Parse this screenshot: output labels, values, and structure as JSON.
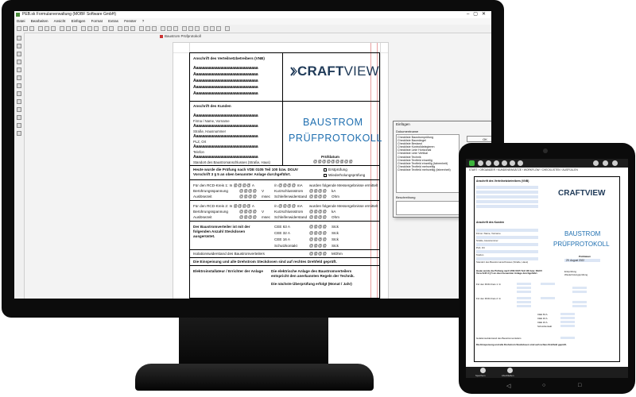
{
  "desktop": {
    "window_title": "PEB.sk Formularverwaltung (MOBF Software GmbH)",
    "menu": [
      "Datei",
      "Bearbeiten",
      "Ansicht",
      "Einfügen",
      "Format",
      "Extras",
      "Fenster",
      "?"
    ],
    "document_title": "Baustrom Prüfprotokoll",
    "form": {
      "vnb_heading": "Anschrift des Verteilnetzbetreibers (VNB)",
      "placeholder_line": "Aaaaaaaaaaaaaaaaaaaaaaaaaaaaaa",
      "logo_text": "CRAFTVIEW",
      "logo_craft": "CRAFT",
      "logo_view": "VIEW",
      "customer_heading": "Anschrift des Kunden",
      "customer_labels": [
        "Firma / Name, Vorname",
        "Straße, Hausnummer",
        "PLZ, Ort",
        "Telefon",
        "Standort des Baustromanschlusses (Straße, Haus)"
      ],
      "title_line1": "BAUSTROM",
      "title_line2": "PRÜFPROTOKOLL",
      "pruefdatum_label": "Prüfdatum",
      "pruefdatum_value": "@@@@@@@@@",
      "test_statement_line1": "Heute wurde die Prüfung nach VDE 0105 Teil 100 bzw. DGUV",
      "test_statement_line2": "Vorschrift 3 § 5 an oben benannter Anlage durchgeführt.",
      "option_1": "Erstprüfung",
      "option_2": "Wiederholungsprüfung",
      "rcd1_label": "Für den RCD-Kreis 1: In",
      "rcd2_label": "Für den RCD-Kreis 2: In",
      "at": "@@@@",
      "unit_a": "A",
      "unit_in": "/n",
      "unit_ma": "mA",
      "unit_v": "V",
      "unit_msec": "msec",
      "unit_ka": "kA",
      "unit_ohm": "Ohm",
      "unit_stck": "Stck",
      "unit_mohm": "MOhm",
      "result_text": "wurden folgende Messergebnisse ermittelt",
      "beruehrung": "Berührungsspannung",
      "auslosezeit": "Auslösezeit",
      "kurzschluss": "Kurzschlussstrom",
      "schleife": "Schleifenwiderstand",
      "verteiler_line1": "Der Baustromverteiler ist mit der",
      "verteiler_line2": "folgenden Anzahl Steckdosen",
      "verteiler_line3": "ausgerüstet.",
      "sockets": [
        "CEE 63 A",
        "CEE 32 A",
        "CEE 16 A",
        "Schutzkontakt"
      ],
      "isolation": "Isolationswiderstand des Baustromverteilers",
      "einspeisung": "Die Einspeisung und alle Drehstrom Steckdosen sind auf rechtes Drehfeld geprüft.",
      "elektro_heading": "Elektroinstallateur / Errichter der Anlage",
      "conformity_line1": "Die elektrische Anlage des Baustromverteilers",
      "conformity_line2": "entspricht den anerkannten Regeln der Technik.",
      "next_check": "Die nächste Überprüfung erfolgt (Monat / Jahr)"
    },
    "dialog": {
      "title": "Einfügen",
      "close": "×",
      "list_label": "Dokumentname",
      "items": [
        "Checkliste Baustromprüfung",
        "Checkliste Baumängel",
        "Checkliste Bestand",
        "Checkliste Kontrolldelegieren",
        "Checkliste Linie Horizontal",
        "Checkliste Linie Vertikal",
        "Checkliste Technik",
        "Checkliste Textfeld einzeilig",
        "Checkliste Textfeld einzeilig (fahrenheit)",
        "Checkliste Textfeld mehrzeilig",
        "Checkliste Textfeld mehrzeilig (fahrenheit)"
      ],
      "ok_label": "OK",
      "cancel_label": "Abbrechen",
      "description_label": "Beschreibung"
    }
  },
  "tablet": {
    "breadcrumb": "START › ORGANIZER › KUNDENEINSÄTZE › WORKFLOW › CHECKLISTEN › AUSFÜLLEN",
    "vnb_heading": "Anschrift des Verteilnetzbetreibers (VNB)",
    "logo_text": "CRAFTVIEW",
    "customer_heading": "Anschrift des Kunden",
    "customer_labels": [
      "Firma / Name, Vorname",
      "Straße, Hausnummer",
      "PLZ, Ort",
      "Telefon",
      "Standort des Baustromanschlusses (Straße, Haus)"
    ],
    "title_line1": "BAUSTROM",
    "title_line2": "PRÜFPROTOKOLL",
    "pruefdatum_label": "Prüfdatum",
    "date_value": "29. August 2022",
    "test_statement": "Heute wurde die Prüfung nach VDE 0105 Teil 100 bzw. DGUV Vorschrift 3 § 5 an oben benannter Anlage durchgeführt.",
    "option_1": "Erstprüfung",
    "option_2": "Wiederholungsprüfung",
    "rcd1": "Für den RCD-Kreis 1: In",
    "rcd2": "Für den RCD-Kreis 2: In",
    "sockets": [
      "CEE 63 A",
      "CEE 32 A",
      "CEE 16 A",
      "Schutzkontakt"
    ],
    "isolation": "Isolationswiderstand des Baustromverteilers",
    "einspeisung": "Die Einspeisung und alle Drehstrom Steckdosen sind auf rechtes Drehfeld geprüft.",
    "bottom_left": "Speichern",
    "bottom_right": "Abschließen"
  }
}
